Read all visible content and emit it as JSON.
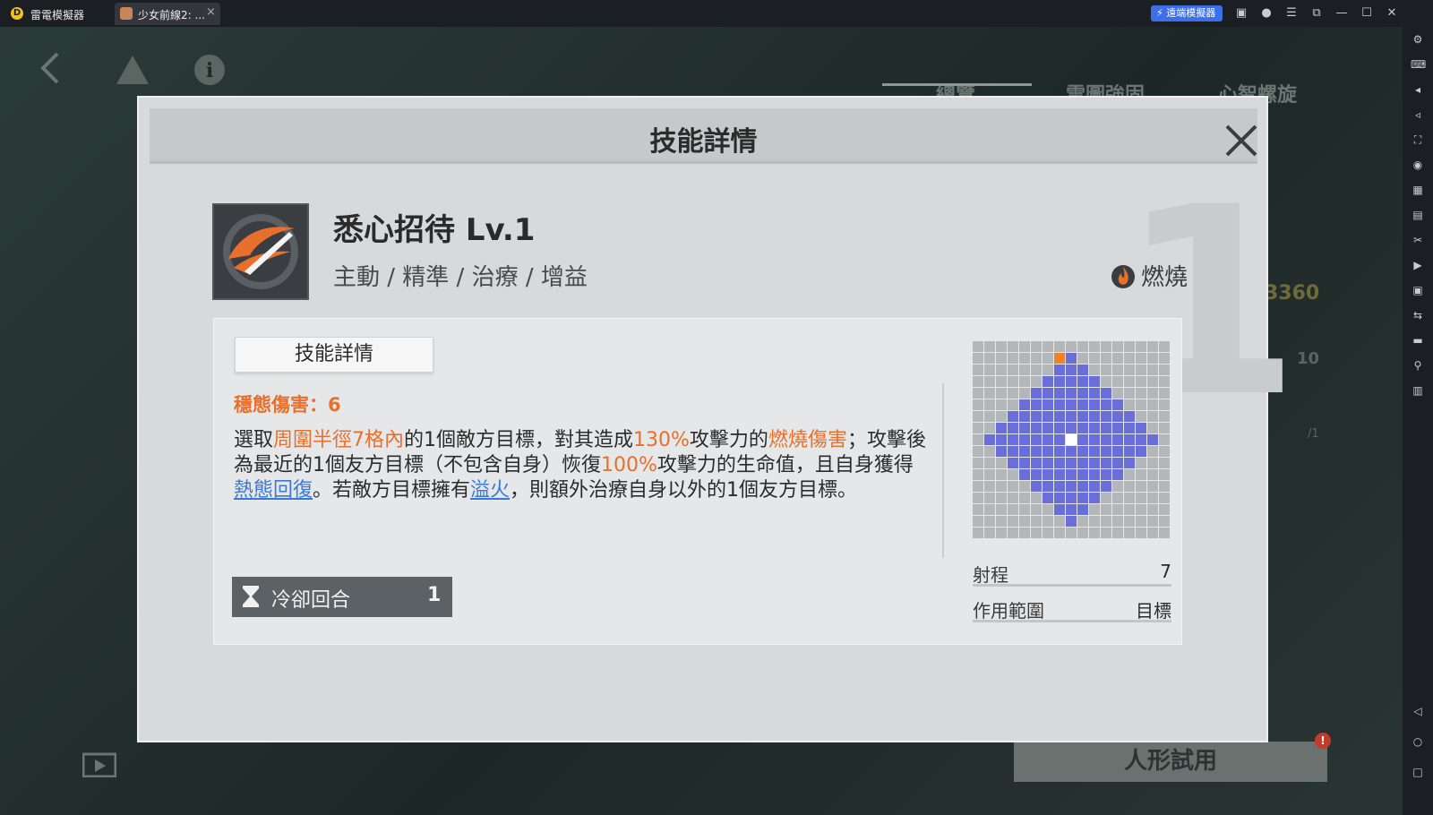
{
  "emulator": {
    "app_name": "雷電模擬器",
    "tab_title": "少女前線2: ...",
    "tab_close": "×",
    "sync_label": "⚡ 遠端模擬器",
    "logo_glyph": "D"
  },
  "game": {
    "tabs": [
      "總覽",
      "雲圖強固",
      "心智螺旋"
    ],
    "side_number": "3360",
    "side_defense": "10",
    "side_turn": "/1",
    "trial_button": "人形試用",
    "alert_badge": "!"
  },
  "dialog": {
    "title": "技能詳情",
    "background_numeral": "1",
    "skill": {
      "name": "悉心招待 Lv.1",
      "tags": "主動 / 精準 / 治療 / 增益",
      "element": "燃燒",
      "element_color": "#e86f2c"
    },
    "panel": {
      "tab_label": "技能詳情",
      "stance_damage": "穩態傷害：6",
      "description": {
        "p1": "選取",
        "h1": "周圍半徑7格內",
        "p2": "的1個敵方目標，對其造成",
        "h2": "130%",
        "p3": "攻擊力的",
        "h3": "燃燒傷害",
        "p4": "；攻擊後為最近的1個友方目標（不包含自身）恢復",
        "h4": "100%",
        "p5": "攻擊力的生命值，且自身獲得",
        "l1": "熱態回復",
        "p6": "。若敵方目標擁有",
        "l2": "溢火",
        "p7": "，則額外治療自身以外的1個友方目標。"
      },
      "cooldown_label": "冷卻回合",
      "cooldown_value": "1"
    },
    "range_grid": {
      "size": 17,
      "range_radius": 7,
      "color_range": "#6a6ed8",
      "color_self": "#ffffff",
      "color_marker": "#f0822c",
      "color_empty": "#b4b7b9"
    },
    "stats": {
      "range_label": "射程",
      "range_value": "7",
      "area_label": "作用範圍",
      "area_value": "目標"
    }
  }
}
